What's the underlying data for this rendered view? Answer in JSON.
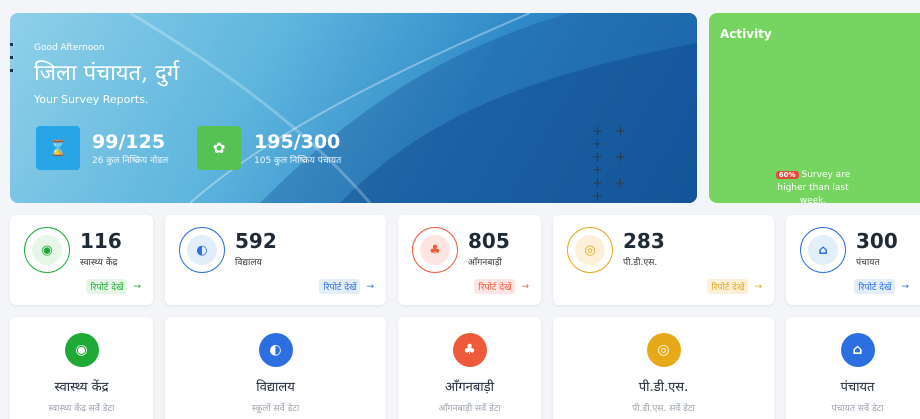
{
  "hero": {
    "greeting": "Good Afternoon",
    "title": "जिला पंचायत, दुर्ग",
    "subtitle": "Your Survey Reports.",
    "stats": [
      {
        "value": "99/125",
        "label": "26 कुल निष्क्रिय नोडल",
        "icon": "hourglass-icon",
        "color": "#26a6e6"
      },
      {
        "value": "195/300",
        "label": "105 कुल निष्क्रिय पंचायत",
        "icon": "cluster-icon",
        "color": "#56c254"
      }
    ],
    "plus_symbols": "+ + +"
  },
  "activity": {
    "title": "Activity",
    "badge": "60%",
    "message": "Survey are higher than last week."
  },
  "cards": [
    {
      "count": "116",
      "label": "स्वास्थ्य केंद्र",
      "link": "रिपोर्ट देखें",
      "arrow": "→",
      "icon": "health-icon",
      "color": "#1faa36",
      "soft": "#e6f6e7"
    },
    {
      "count": "592",
      "label": "विद्यालय",
      "link": "रिपोर्ट देखें",
      "arrow": "→",
      "icon": "school-icon",
      "color": "#2b6fe0",
      "soft": "#e3eefb"
    },
    {
      "count": "805",
      "label": "आँगनबाड़ी",
      "link": "रिपोर्ट देखें",
      "arrow": "→",
      "icon": "anganwadi-icon",
      "color": "#ef5a3a",
      "soft": "#fde6e1"
    },
    {
      "count": "283",
      "label": "पी.डी.एस.",
      "link": "रिपोर्ट देखें",
      "arrow": "→",
      "icon": "pds-icon",
      "color": "#e6a917",
      "soft": "#fcf1d8"
    },
    {
      "count": "300",
      "label": "पंचायत",
      "link": "रिपोर्ट देखें",
      "arrow": "→",
      "icon": "panchayat-icon",
      "color": "#2b6fe0",
      "soft": "#e3eefb"
    }
  ],
  "tiles": [
    {
      "name": "स्वास्थ्य केंद्र",
      "sub": "स्वास्थ्य केंद्र सर्वे डेटा",
      "icon": "health-icon",
      "color": "#1faa36"
    },
    {
      "name": "विद्यालय",
      "sub": "स्कूलों सर्वे डेटा",
      "icon": "school-icon",
      "color": "#2b6fe0"
    },
    {
      "name": "आँगनबाड़ी",
      "sub": "आँगनबाड़ी सर्वे डेटा",
      "icon": "anganwadi-icon",
      "color": "#ef5a3a"
    },
    {
      "name": "पी.डी.एस.",
      "sub": "पी.डी.एस. सर्वे डेटा",
      "icon": "pds-icon",
      "color": "#e6a917"
    },
    {
      "name": "पंचायत",
      "sub": "पंचायत सर्वे डेटा",
      "icon": "panchayat-icon",
      "color": "#2b6fe0"
    }
  ]
}
